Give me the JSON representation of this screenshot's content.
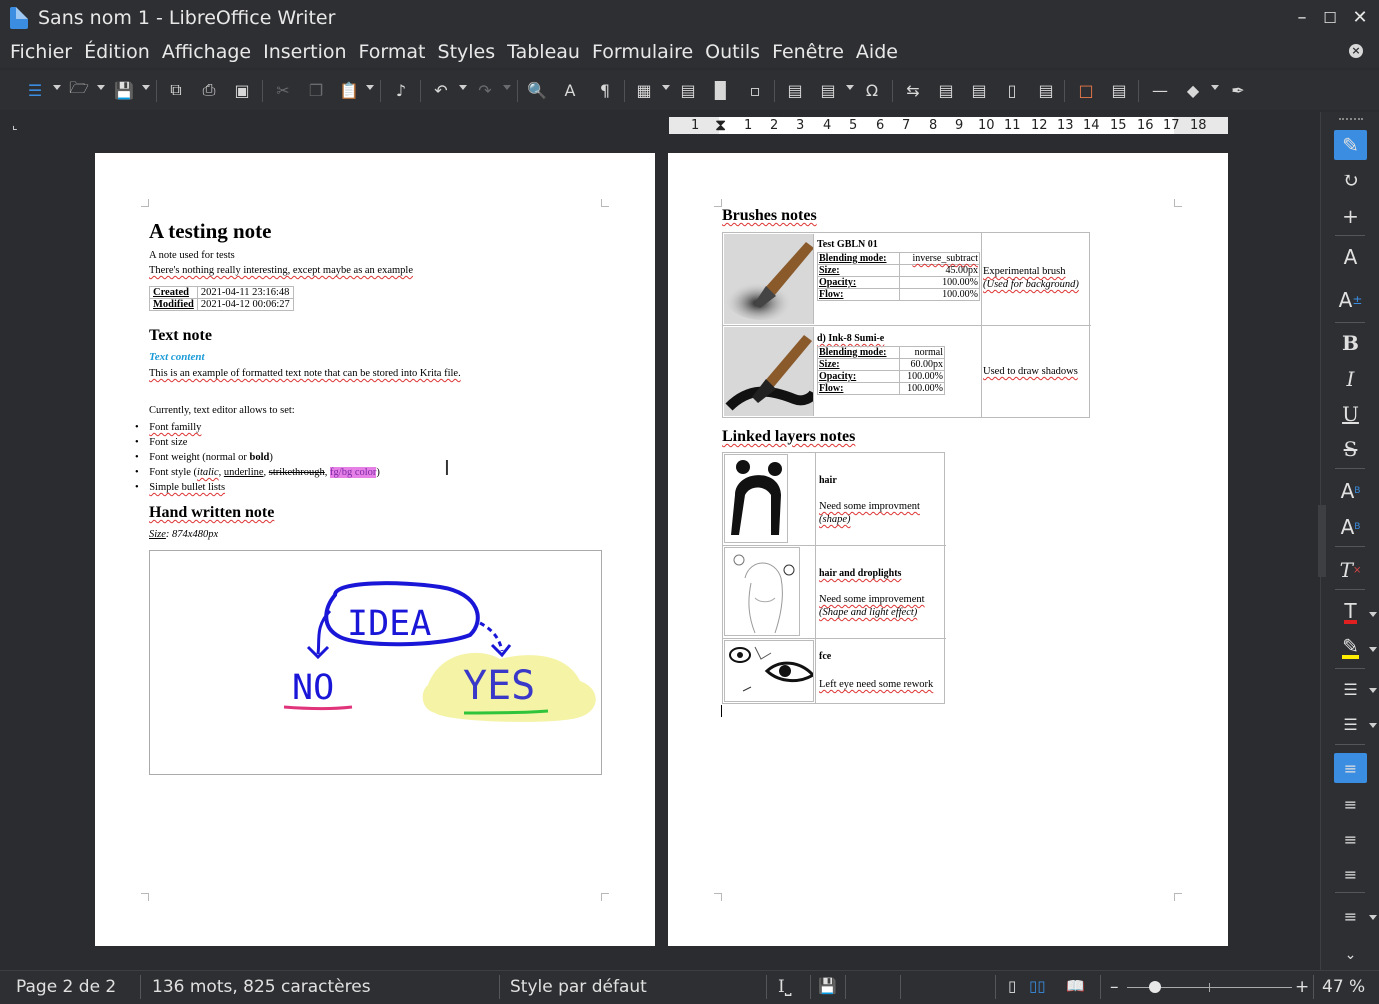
{
  "window": {
    "title": "Sans nom 1 - LibreOffice Writer"
  },
  "menu": [
    "Fichier",
    "Édition",
    "Affichage",
    "Insertion",
    "Format",
    "Styles",
    "Tableau",
    "Formulaire",
    "Outils",
    "Fenêtre",
    "Aide"
  ],
  "ruler": {
    "ticks": [
      "1",
      "1",
      "2",
      "3",
      "4",
      "5",
      "6",
      "7",
      "8",
      "9",
      "10",
      "11",
      "12",
      "13",
      "14",
      "15",
      "16",
      "17",
      "18"
    ]
  },
  "page1": {
    "title": "A testing note",
    "intro1": "A note used for tests",
    "intro2": "There's nothing really interesting, except maybe as an example",
    "meta": [
      {
        "label": "Created",
        "value": "2021-04-11 23:16:48"
      },
      {
        "label": "Modified",
        "value": "2021-04-12 00:06:27"
      }
    ],
    "text_heading": "Text note",
    "text_content_title": "Text content",
    "text_para": "This is an example of formatted text note that can be stored into Krita file.",
    "currently": "Currently, text editor allows to set:",
    "bullets": {
      "b1": "Font familly",
      "b2": "Font size",
      "b3_pre": "Font weight (normal or ",
      "b3_bold": "bold",
      "b3_post": ")",
      "b4_pre": "Font style (",
      "b4_italic": "italic",
      "b4_sep1": ", ",
      "b4_underline": "underline",
      "b4_sep2": ", ",
      "b4_strike": "strikethrough",
      "b4_sep3": ", ",
      "b4_color": "fg/bg color",
      "b4_post": ")",
      "b5": "Simple bullet lists"
    },
    "hand_heading": "Hand written note",
    "size_label": "Size",
    "size_value": ": 874x480px",
    "drawing": {
      "idea": "IDEA",
      "no": "NO",
      "yes": "YES"
    }
  },
  "page2": {
    "brushes_heading": "Brushes notes",
    "brushes": [
      {
        "name": "Test GBLN 01",
        "blending_label": "Blending mode:",
        "blending": "inverse_subtract",
        "size": "45.00px",
        "opacity": "100.00%",
        "flow": "100.00%",
        "note_line1": "Experimental brush",
        "note_line2": "(Used for background)"
      },
      {
        "name": "d) Ink-8 Sumi-e",
        "blending_label": "Blending mode:",
        "blending": "normal",
        "size": "60.00px",
        "opacity": "100.00%",
        "flow": "100.00%",
        "note_line1": "Used to draw shadows",
        "note_line2": ""
      }
    ],
    "labels": {
      "size": "Size:",
      "opacity": "Opacity:",
      "flow": "Flow:"
    },
    "linked_heading": "Linked layers notes",
    "layers": [
      {
        "name": "hair",
        "note": "Need some improvment",
        "note2": "(shape)"
      },
      {
        "name": "hair and droplights",
        "note": "Need some improvement",
        "note2": "(Shape and light effect)"
      },
      {
        "name": "fce",
        "note": "Left eye need some rework",
        "note2": ""
      }
    ]
  },
  "status": {
    "page": "Page 2 de 2",
    "words": "136 mots, 825 caractères",
    "style": "Style par défaut",
    "zoom": "47 %"
  },
  "colors": {
    "accent": "#3a8de0",
    "bg": "#2b2c2f",
    "highlight": "#e67fe6",
    "link_blue": "#1a9bd7"
  }
}
